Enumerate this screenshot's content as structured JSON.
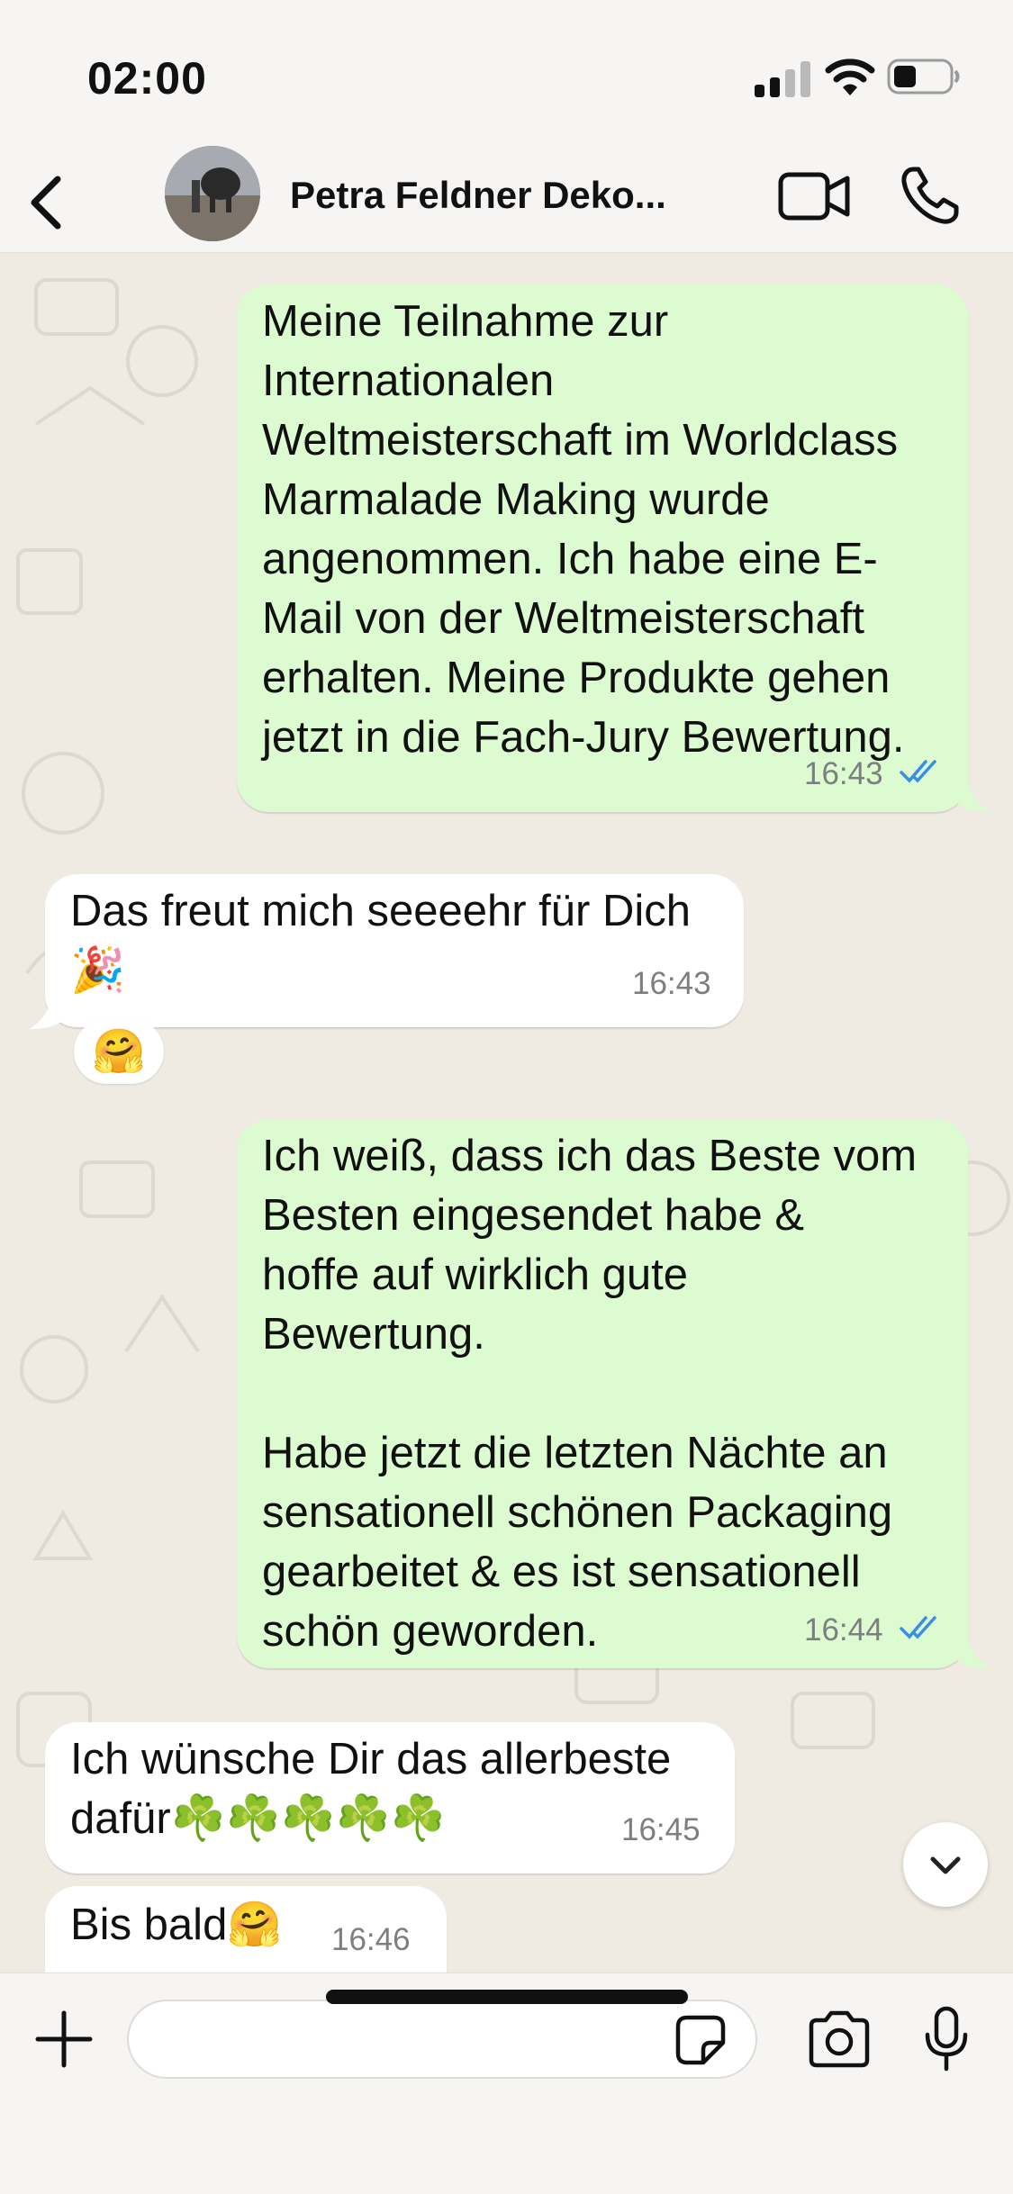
{
  "status_bar": {
    "time": "02:00"
  },
  "header": {
    "contact_name": "Petra Feldner Deko..."
  },
  "messages": [
    {
      "direction": "out",
      "text": "Meine Teilnahme zur\nInternationalen\nWeltmeisterschaft im Worldclass\nMarmalade Making wurde\nangenommen. Ich habe eine E-\nMail von der Weltmeisterschaft\nerhalten. Meine Produkte gehen\njetzt in die Fach-Jury Bewertung.",
      "time": "16:43",
      "status": "read"
    },
    {
      "direction": "in",
      "text": "Das freut mich seeeehr für Dich\n🎉",
      "time": "16:43",
      "reaction": "🤗"
    },
    {
      "direction": "out",
      "text": "Ich weiß, dass ich das Beste vom\nBesten eingesendet habe &\nhoffe auf wirklich gute\nBewertung.\n\nHabe jetzt die letzten Nächte an\nsensationell schönen Packaging\ngearbeitet & es ist sensationell\nschön geworden.",
      "time": "16:44",
      "status": "read"
    },
    {
      "direction": "in",
      "text": "Ich wünsche Dir das allerbeste\ndafür☘️☘️☘️☘️☘️",
      "time": "16:45"
    },
    {
      "direction": "in",
      "text": "Bis bald🤗",
      "time": "16:46"
    }
  ],
  "input": {
    "placeholder": ""
  },
  "colors": {
    "outgoing_bubble": "#ddfbd1",
    "incoming_bubble": "#ffffff",
    "read_ticks": "#3a8ee6",
    "chat_background": "#efeae2"
  },
  "icons": [
    "back-chevron-icon",
    "video-camera-icon",
    "phone-icon",
    "double-check-icon",
    "chevron-down-icon",
    "plus-icon",
    "sticker-icon",
    "camera-icon",
    "microphone-icon"
  ]
}
